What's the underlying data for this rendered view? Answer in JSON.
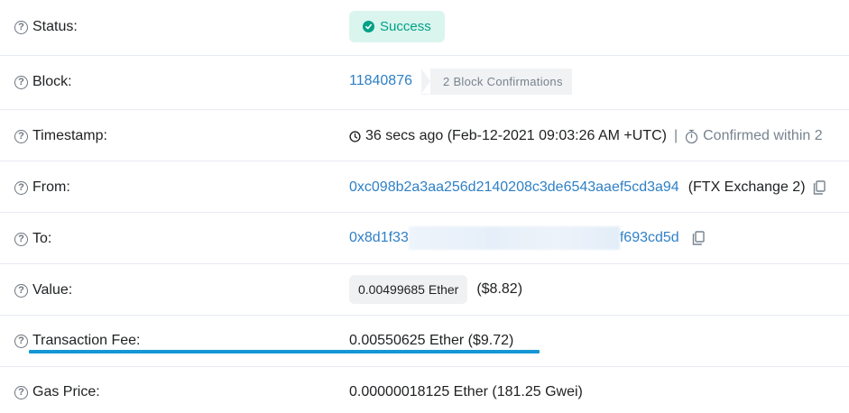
{
  "rows": {
    "status": {
      "label": "Status:",
      "badge": "Success"
    },
    "block": {
      "label": "Block:",
      "number": "11840876",
      "confirmations": "2 Block Confirmations"
    },
    "timestamp": {
      "label": "Timestamp:",
      "value": "36 secs ago (Feb-12-2021 09:03:26 AM +UTC)",
      "separator": "|",
      "confirmed": "Confirmed within 2"
    },
    "from": {
      "label": "From:",
      "address": "0xc098b2a3aa256d2140208c3de6543aaef5cd3a94",
      "name": "(FTX Exchange 2)"
    },
    "to": {
      "label": "To:",
      "address_start": "0x8d1f33",
      "address_end": "f693cd5d"
    },
    "value": {
      "label": "Value:",
      "amount": "0.00499685 Ether",
      "usd": "($8.82)"
    },
    "fee": {
      "label": "Transaction Fee:",
      "amount": "0.00550625 Ether ($9.72)"
    },
    "gas": {
      "label": "Gas Price:",
      "amount": "0.00000018125 Ether (181.25 Gwei)"
    }
  },
  "colors": {
    "link": "#2f80c6",
    "success": "#00a186",
    "highlight": "#1497d4"
  },
  "icons": {
    "help": "question-circle-icon",
    "check": "check-circle-icon",
    "clock": "clock-icon",
    "timer": "stopwatch-icon",
    "copy": "copy-icon"
  }
}
